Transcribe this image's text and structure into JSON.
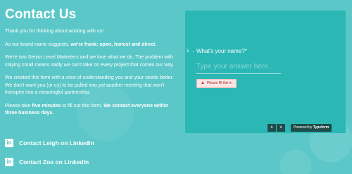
{
  "page": {
    "title": "Contact Us",
    "paragraphs": [
      {
        "pre": "Thank you for thinking about working with us!",
        "bold": "",
        "post": ""
      },
      {
        "pre": "As our brand name suggests, ",
        "bold": "we're frank: open, honest and direct.",
        "post": ""
      },
      {
        "pre": "We're two Senior Level Marketers and we love what we do. The problem with staying small means sadly we can't take on every project that comes our way.",
        "bold": "",
        "post": ""
      }
    ],
    "para4": {
      "pre": "We created this form with a view of understanding you and your needs better. We don't want you (or us) to be pulled into ",
      "italic": "yet",
      "post": " another meeting that won't transpire into a meaningful partnership."
    },
    "para5": {
      "pre": "Please take ",
      "bold1": "five minutes",
      "mid": " to fill out this form. ",
      "bold2": "We contact everyone within three business days."
    },
    "links": [
      {
        "label": "Contact Leigh on LinkedIn",
        "icon": "linkedin-icon"
      },
      {
        "label": "Contact Zoe on LinkedIn",
        "icon": "linkedin-icon"
      }
    ]
  },
  "form": {
    "question_number": "1 →",
    "question": "What's your name?*",
    "answer_value": "",
    "answer_placeholder": "Type your answer here...",
    "error": "Please fill this in",
    "nav_up": "∧",
    "nav_down": "∨",
    "powered_pre": "Powered by ",
    "powered_brand": "Typeform"
  },
  "colors": {
    "background": "#5cc7c8",
    "panel": "#2bb7b4",
    "dark_button": "#1f4b4a",
    "error_text": "#b42323"
  }
}
